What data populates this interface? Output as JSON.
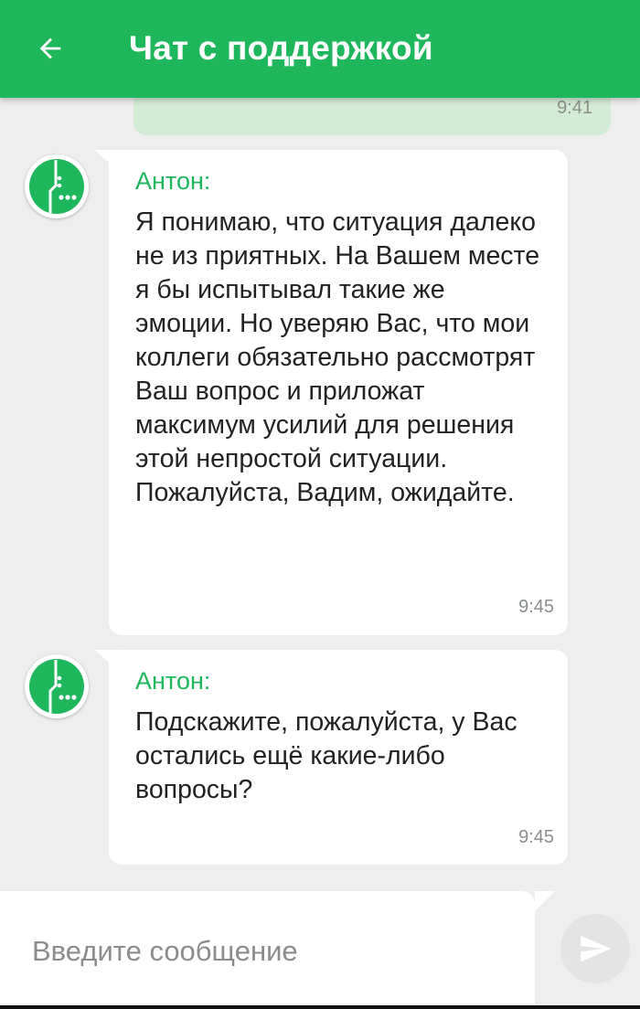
{
  "header": {
    "title": "Чат с поддержкой",
    "back_icon": "arrow-left-icon",
    "color": "#1eb75c"
  },
  "outgoing": {
    "time": "9:41",
    "bubble_color": "#d3ecd6"
  },
  "messages": [
    {
      "sender": "Антон:",
      "text": "Я понимаю, что ситуация далеко не из приятных. На Вашем месте я бы испытывал такие же эмоции. Но уверяю Вас, что мои коллеги обязательно рассмотрят Ваш вопрос и приложат максимум усилий для решения этой непростой ситуации. Пожалуйста, Вадим, ожидайте.",
      "time": "9:45",
      "avatar_icon": "megafon-logo-icon"
    },
    {
      "sender": "Антон:",
      "text": "Подскажите, пожалуйста, у Вас остались ещё какие-либо вопросы?",
      "time": "9:45",
      "avatar_icon": "megafon-logo-icon"
    }
  ],
  "composer": {
    "placeholder": "Введите сообщение",
    "value": "",
    "send_icon": "send-icon"
  },
  "colors": {
    "accent": "#1eb75c",
    "background": "#eeeeee",
    "incoming_bubble": "#ffffff"
  }
}
